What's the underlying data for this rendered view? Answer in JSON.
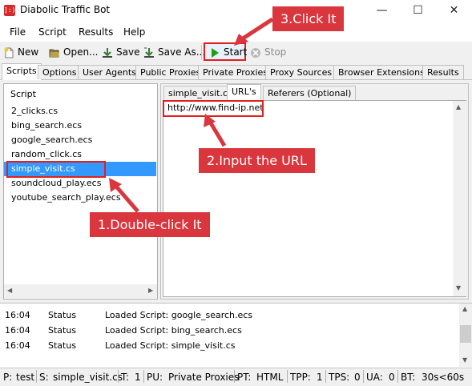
{
  "window": {
    "title": "Diabolic Traffic Bot",
    "app_icon_text": "]:)",
    "minimize": "—",
    "maximize": "☐",
    "close": "✕"
  },
  "menu": [
    "File",
    "Script",
    "Results",
    "Help"
  ],
  "toolbar": {
    "new": "New",
    "open": "Open...",
    "save": "Save",
    "save_as": "Save As...",
    "start": "Start",
    "stop": "Stop"
  },
  "tabs": [
    "Scripts",
    "Options",
    "User Agents",
    "Public Proxies",
    "Private Proxies",
    "Proxy Sources",
    "Browser Extensions",
    "Results"
  ],
  "scripts": {
    "header": "Script",
    "items": [
      "2_clicks.cs",
      "bing_search.ecs",
      "google_search.ecs",
      "random_click.cs",
      "simple_visit.cs",
      "soundcloud_play.ecs",
      "youtube_search_play.ecs"
    ],
    "selected": "simple_visit.cs"
  },
  "subtabs": [
    "simple_visit.cs",
    "URL's",
    "Referers (Optional)"
  ],
  "url_text": "http://www.find-ip.net",
  "annotations": {
    "step1": "1.Double-click It",
    "step2": "2.Input the URL",
    "step3": "3.Click It"
  },
  "log": [
    {
      "time": "16:04",
      "type": "Status",
      "message": "Loaded Script: google_search.ecs"
    },
    {
      "time": "16:04",
      "type": "Status",
      "message": "Loaded Script: bing_search.ecs"
    },
    {
      "time": "16:04",
      "type": "Status",
      "message": "Loaded Script: simple_visit.cs"
    }
  ],
  "statusbar": {
    "p_label": "P:",
    "p_value": "test",
    "s_label": "S:",
    "s_value": "simple_visit.cs",
    "t_label": "T:",
    "t_value": "1",
    "pu_label": "PU:",
    "pu_value": "Private Proxies",
    "pt_label": "PT:",
    "pt_value": "HTML",
    "tpp_label": "TPP:",
    "tpp_value": "1",
    "tps_label": "TPS:",
    "tps_value": "0",
    "ua_label": "UA:",
    "ua_value": "0",
    "bt_label": "BT:",
    "bt_value": "30s<60s"
  },
  "colors": {
    "highlight_red": "#e02020",
    "callout_red": "#d9363e",
    "selection_blue": "#3399ff",
    "start_green": "#1e9e1e"
  }
}
